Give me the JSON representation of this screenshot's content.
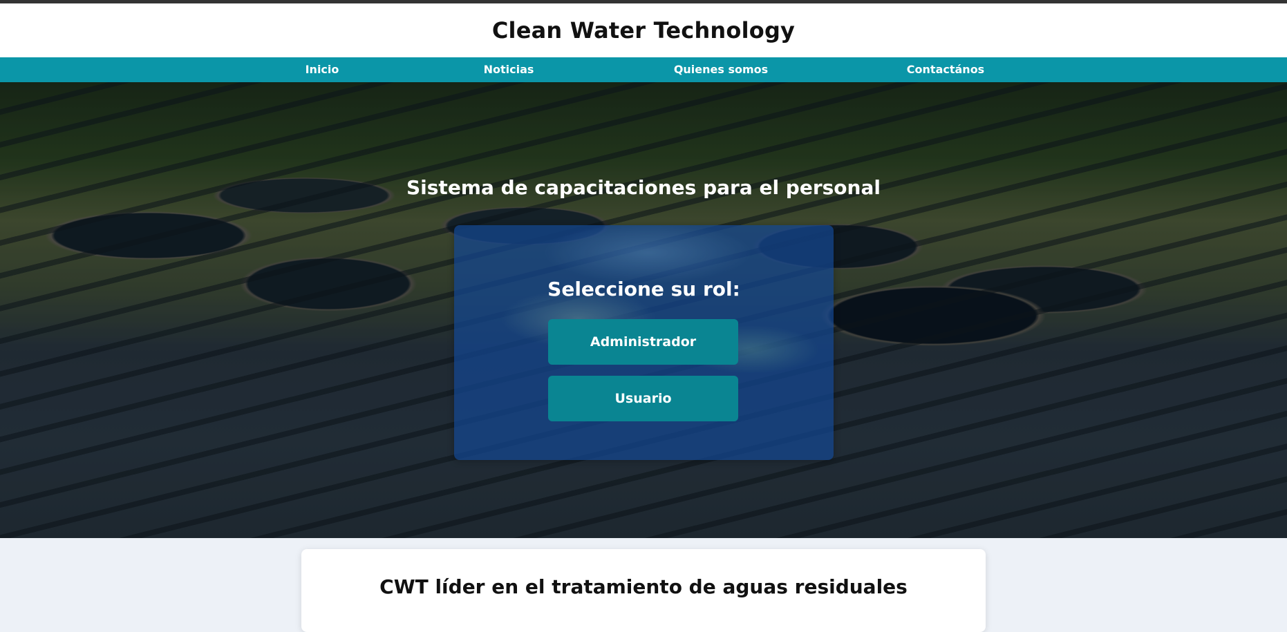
{
  "header": {
    "site_title": "Clean Water Technology"
  },
  "nav": {
    "items": [
      {
        "label": "Inicio"
      },
      {
        "label": "Noticias"
      },
      {
        "label": "Quienes somos"
      },
      {
        "label": "Contactános"
      }
    ]
  },
  "hero": {
    "title": "Sistema de capacitaciones para el personal",
    "role_panel": {
      "heading": "Seleccione su rol:",
      "buttons": [
        {
          "label": "Administrador"
        },
        {
          "label": "Usuario"
        }
      ]
    }
  },
  "content": {
    "card_title": "CWT líder en el tratamiento de aguas residuales"
  },
  "colors": {
    "nav_background": "#0b96a8",
    "role_button": "#0a8592",
    "panel_overlay": "#14468f",
    "top_strip": "#333333"
  }
}
